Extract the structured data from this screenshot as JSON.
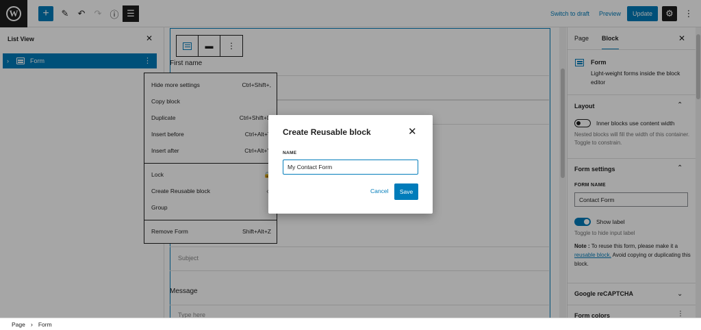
{
  "topbar": {
    "switch_to_draft": "Switch to draft",
    "preview": "Preview",
    "update": "Update"
  },
  "listview": {
    "title": "List View",
    "item_label": "Form"
  },
  "canvas": {
    "first_name_label": "First name",
    "subject_placeholder": "Subject",
    "message_label": "Message",
    "message_placeholder": "Type here"
  },
  "context_menu": {
    "items": [
      {
        "label": "Hide more settings",
        "shortcut": "Ctrl+Shift+,"
      },
      {
        "label": "Copy block",
        "shortcut": ""
      },
      {
        "label": "Duplicate",
        "shortcut": "Ctrl+Shift+D"
      },
      {
        "label": "Insert before",
        "shortcut": "Ctrl+Alt+T"
      },
      {
        "label": "Insert after",
        "shortcut": "Ctrl+Alt+Y"
      },
      {
        "label": "Lock",
        "shortcut": ""
      },
      {
        "label": "Create Reusable block",
        "shortcut": ""
      },
      {
        "label": "Group",
        "shortcut": ""
      },
      {
        "label": "Remove Form",
        "shortcut": "Shift+Alt+Z"
      }
    ]
  },
  "sidebar": {
    "tab_page": "Page",
    "tab_block": "Block",
    "block_name": "Form",
    "block_desc": "Light-weight forms inside the block editor",
    "layout_title": "Layout",
    "inner_blocks_label": "Inner blocks use content width",
    "inner_blocks_help": "Nested blocks will fill the width of this container. Toggle to constrain.",
    "form_settings_title": "Form settings",
    "form_name_label": "FORM NAME",
    "form_name_value": "Contact Form",
    "show_label": "Show label",
    "show_label_help": "Toggle to hide input label",
    "note_prefix": "Note :",
    "note_text": " To reuse this form, please make it a ",
    "note_link": "reusable block.",
    "note_suffix": " Avoid copying or duplicating this block.",
    "recaptcha_title": "Google reCAPTCHA",
    "form_colors_title": "Form colors"
  },
  "modal": {
    "title": "Create Reusable block",
    "name_label": "NAME",
    "name_value": "My Contact Form",
    "cancel": "Cancel",
    "save": "Save"
  },
  "footer": {
    "crumb_page": "Page",
    "crumb_form": "Form"
  }
}
